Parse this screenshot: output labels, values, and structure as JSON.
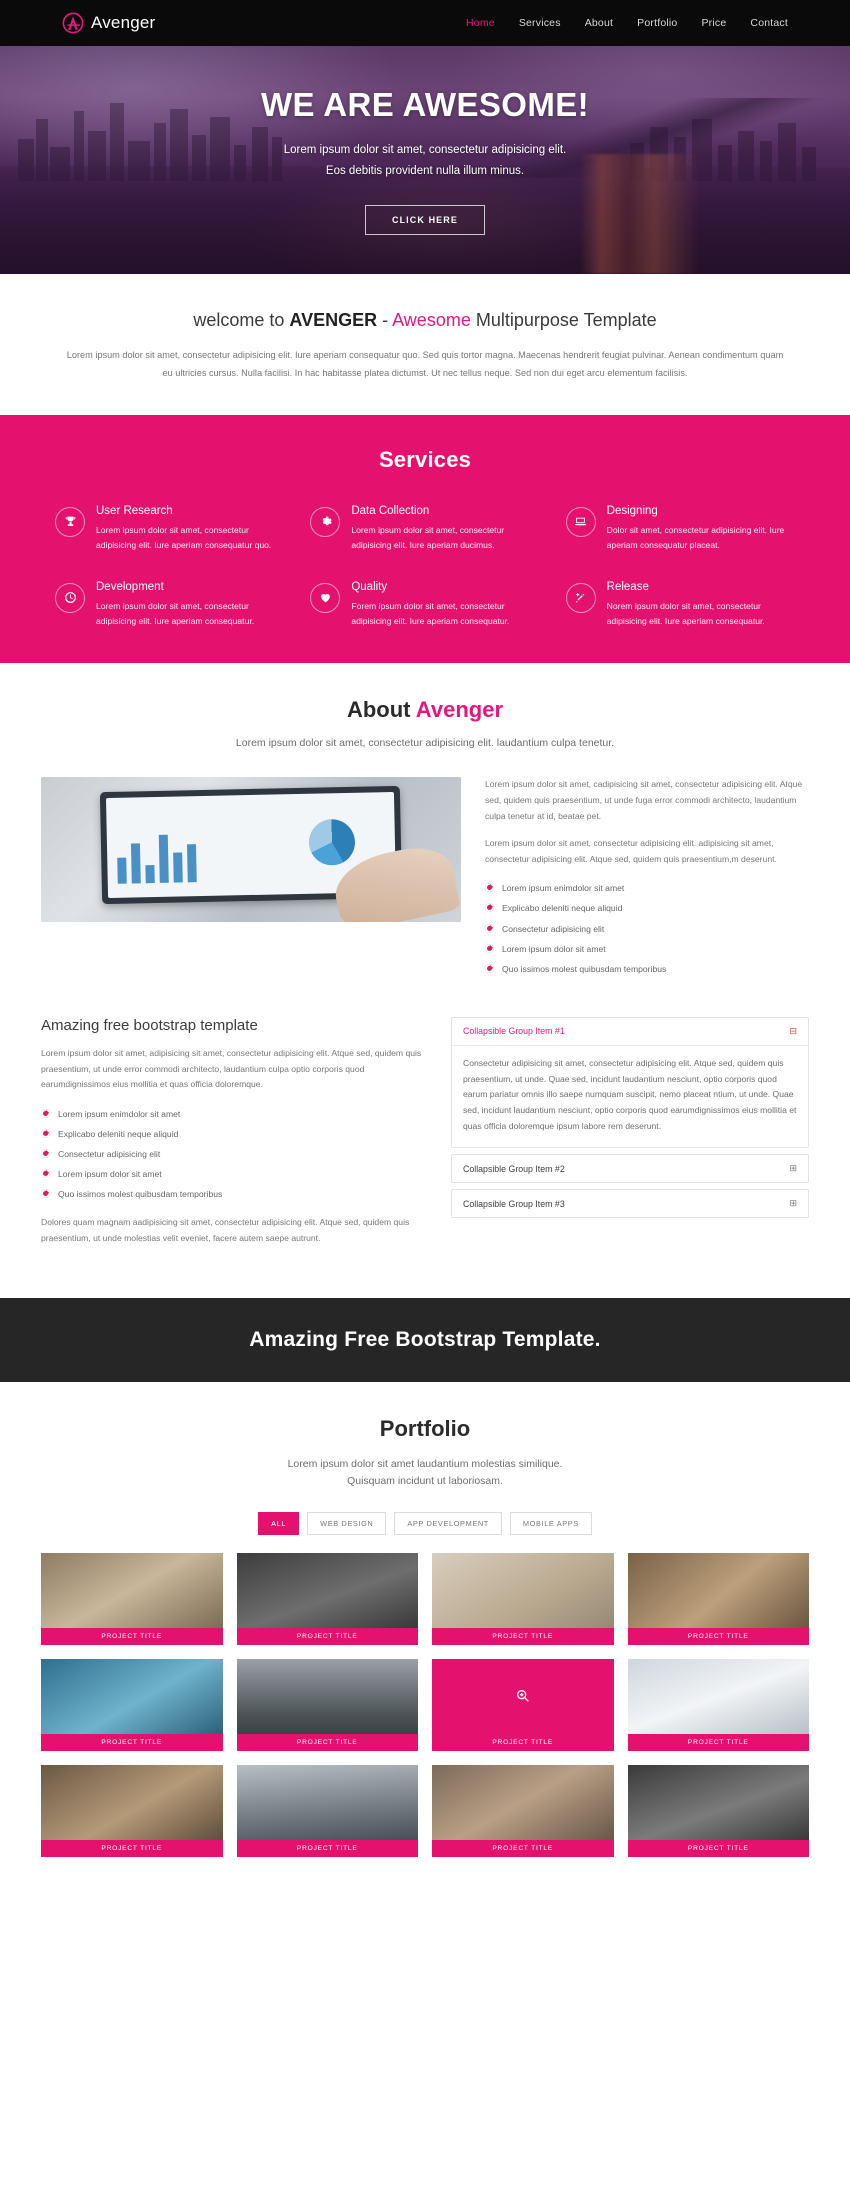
{
  "navbar": {
    "brand": "Avenger",
    "brand_icon": "avenger-a-logo-icon",
    "accent_color": "#e5177f",
    "links": [
      {
        "label": "Home",
        "active": true
      },
      {
        "label": "Services",
        "active": false
      },
      {
        "label": "About",
        "active": false
      },
      {
        "label": "Portfolio",
        "active": false
      },
      {
        "label": "Price",
        "active": false
      },
      {
        "label": "Contact",
        "active": false
      }
    ]
  },
  "hero": {
    "title": "WE ARE AWESOME!",
    "subtitle_line1": "Lorem ipsum dolor sit amet, consectetur adipisicing elit.",
    "subtitle_line2": "Eos debitis provident nulla illum minus.",
    "button_label": "CLICK HERE"
  },
  "welcome": {
    "title_part1": "welcome to ",
    "title_bold": "AVENGER",
    "title_dash": " - ",
    "title_accent": "Awesome",
    "title_part2": " Multipurpose Template",
    "paragraph": "Lorem ipsum dolor sit amet, consectetur adipisicing elit. Iure aperiam consequatur quo. Sed quis tortor magna. Maecenas hendrerit feugiat pulvinar. Aenean condimentum quam eu ultricies cursus. Nulla facilisi. In hac habitasse platea dictumst. Ut nec tellus neque. Sed non dui eget arcu elementum facilisis."
  },
  "services": {
    "heading": "Services",
    "bg_color": "#e5116e",
    "items": [
      {
        "icon": "trophy-icon",
        "title": "User Research",
        "text": "Lorem ipsum dolor sit amet, consectetur adipisicing elit. Iure aperiam consequatur quo."
      },
      {
        "icon": "gear-icon",
        "title": "Data Collection",
        "text": "Lorem ipsum dolor sit amet, consectetur adipisicing elit. Iure aperiam ducimus."
      },
      {
        "icon": "laptop-icon",
        "title": "Designing",
        "text": "Dolor sit amet, consectetur adipisicing elit. Iure aperiam consequatur placeat."
      },
      {
        "icon": "clock-icon",
        "title": "Development",
        "text": "Lorem ipsum dolor sit amet, consectetur adipisicing elit. Iure aperiam consequatur."
      },
      {
        "icon": "heart-icon",
        "title": "Quality",
        "text": "Forem ipsum dolor sit amet, consectetur adipisicing elit. Iure aperiam consequatur."
      },
      {
        "icon": "magic-wand-icon",
        "title": "Release",
        "text": "Norem ipsum dolor sit amet, consectetur adipisicing elit. Iure aperiam consequatur."
      }
    ]
  },
  "about": {
    "heading_part1": "About ",
    "heading_accent": "Avenger",
    "lead": "Lorem ipsum dolor sit amet, consectetur adipisicing elit. laudantium culpa tenetur.",
    "image_alt": "tablet-analytics-dashboard-photo",
    "paragraph1": "Lorem ipsum dolor sit amet, cadipisicing sit amet, consectetur adipisicing elit. Atque sed, quidem quis praesentium, ut unde fuga error commodi architecto, laudantium culpa tenetur at id, beatae pet.",
    "paragraph2": "Lorem ipsum dolor sit amet, consectetur adipisicing elit. adipisicing sit amet, consectetur adipisicing elit. Atque sed, quidem quis praesentium,m deserunt.",
    "list": [
      "Lorem ipsum enimdolor sit amet",
      "Explicabo deleniti neque aliquid",
      "Consectetur adipisicing elit",
      "Lorem ipsum dolor sit amet",
      "Quo issimos molest quibusdam temporibus"
    ]
  },
  "bootstrap_section": {
    "heading": "Amazing free bootstrap template",
    "paragraph1": "Lorem ipsum dolor sit amet, adipisicing sit amet, consectetur adipisicing elit. Atque sed, quidem quis praesentium, ut unde error commodi architecto, laudantium culpa optio corporis quod earumdignissimos eius mollitia et quas officia doloremque.",
    "list": [
      "Lorem ipsum enimdolor sit amet",
      "Explicabo deleniti neque aliquid",
      "Consectetur adipisicing elit",
      "Lorem ipsum dolor sit amet",
      "Quo issimos molest quibusdam temporibus"
    ],
    "paragraph2": "Dolores quam magnam aadipisicing sit amet, consectetur adipisicing elit. Atque sed, quidem quis praesentium, ut unde molestias velit eveniet, facere autem saepe autrunt.",
    "accordion": [
      {
        "title": "Collapsible Group Item #1",
        "open": true,
        "sign": "⊟",
        "body": "Consectetur adipisicing sit amet, consectetur adipisicing elit. Atque sed, quidem quis praesentium, ut unde. Quae sed, incidunt laudantium nesciunt, optio corporis quod earum pariatur omnis illo saepe numquam suscipit, nemo placeat ntium, ut unde. Quae sed, incidunt laudantium nesciunt, optio corporis quod earumdignissimos eius mollitia et quas officia doloremque ipsum labore rem deserunt."
      },
      {
        "title": "Collapsible Group Item #2",
        "open": false,
        "sign": "⊞",
        "body": ""
      },
      {
        "title": "Collapsible Group Item #3",
        "open": false,
        "sign": "⊞",
        "body": ""
      }
    ]
  },
  "banner": {
    "title": "Amazing Free Bootstrap Template."
  },
  "portfolio": {
    "heading": "Portfolio",
    "lead_line1": "Lorem ipsum dolor sit amet laudantium molestias similique.",
    "lead_line2": "Quisquam incidunt ut laboriosam.",
    "filters": [
      {
        "label": "ALL",
        "active": true
      },
      {
        "label": "WEB DESIGN",
        "active": false
      },
      {
        "label": "APP DEVELOPMENT",
        "active": false
      },
      {
        "label": "MOBILE APPS",
        "active": false
      }
    ],
    "item_caption": "PROJECT TITLE",
    "items": [
      {
        "caption": "PROJECT TITLE",
        "swatch": "p1",
        "hover": false
      },
      {
        "caption": "PROJECT TITLE",
        "swatch": "p2",
        "hover": false
      },
      {
        "caption": "PROJECT TITLE",
        "swatch": "p3",
        "hover": false
      },
      {
        "caption": "PROJECT TITLE",
        "swatch": "p4",
        "hover": false
      },
      {
        "caption": "PROJECT TITLE",
        "swatch": "p5",
        "hover": false
      },
      {
        "caption": "PROJECT TITLE",
        "swatch": "p6",
        "hover": false
      },
      {
        "caption": "PROJECT TITLE",
        "swatch": "p7",
        "hover": true
      },
      {
        "caption": "PROJECT TITLE",
        "swatch": "p8",
        "hover": false
      },
      {
        "caption": "PROJECT TITLE",
        "swatch": "p9",
        "hover": false
      },
      {
        "caption": "PROJECT TITLE",
        "swatch": "p10",
        "hover": false
      },
      {
        "caption": "PROJECT TITLE",
        "swatch": "p11",
        "hover": false
      },
      {
        "caption": "PROJECT TITLE",
        "swatch": "p12",
        "hover": false
      }
    ]
  }
}
